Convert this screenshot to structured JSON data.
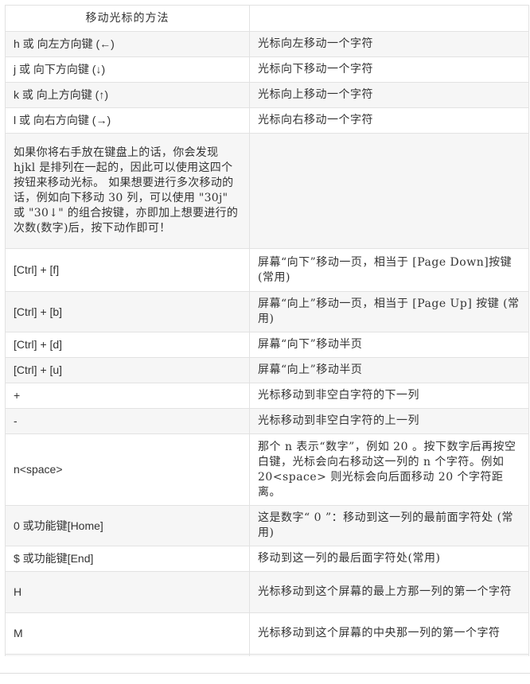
{
  "table": {
    "header": [
      "移动光标的方法",
      ""
    ],
    "rows": [
      {
        "key": "h 或 向左方向键 (←)",
        "desc": "光标向左移动一个字符"
      },
      {
        "key": "j 或 向下方向键 (↓)",
        "desc": "光标向下移动一个字符"
      },
      {
        "key": "k 或 向上方向键 (↑)",
        "desc": "光标向上移动一个字符"
      },
      {
        "key": "l 或 向右方向键 (→)",
        "desc": "光标向右移动一个字符"
      },
      {
        "key": "如果你将右手放在键盘上的话，你会发现 hjkl 是排列在一起的，因此可以使用这四个按钮来移动光标。 如果想要进行多次移动的话，例如向下移动 30 列，可以使用 \"30j\" 或 \"30↓\" 的组合按键，亦即加上想要进行的次数(数字)后，按下动作即可！",
        "desc": ""
      },
      {
        "key": "[Ctrl] + [f]",
        "desc": "屏幕“向下”移动一页，相当于 [Page Down]按键 (常用)"
      },
      {
        "key": "[Ctrl] + [b]",
        "desc": "屏幕“向上”移动一页，相当于 [Page Up] 按键 (常用)"
      },
      {
        "key": "[Ctrl] + [d]",
        "desc": "屏幕“向下”移动半页"
      },
      {
        "key": "[Ctrl] + [u]",
        "desc": "屏幕“向上”移动半页"
      },
      {
        "key": "+",
        "desc": "光标移动到非空白字符的下一列"
      },
      {
        "key": "-",
        "desc": "光标移动到非空白字符的上一列"
      },
      {
        "key": "n<space>",
        "desc": "那个 n 表示“数字”，例如 20 。按下数字后再按空白键，光标会向右移动这一列的 n 个字符。例如 20<space> 则光标会向后面移动 20 个字符距离。"
      },
      {
        "key": "0 或功能键[Home]",
        "desc": "这是数字“ 0 ”：移动到这一列的最前面字符处 (常用)"
      },
      {
        "key": "$ 或功能键[End]",
        "desc": "移动到这一列的最后面字符处(常用)"
      },
      {
        "key": "H",
        "desc": "光标移动到这个屏幕的最上方那一列的第一个字符"
      },
      {
        "key": "M",
        "desc": "光标移动到这个屏幕的中央那一列的第一个字符"
      }
    ]
  }
}
